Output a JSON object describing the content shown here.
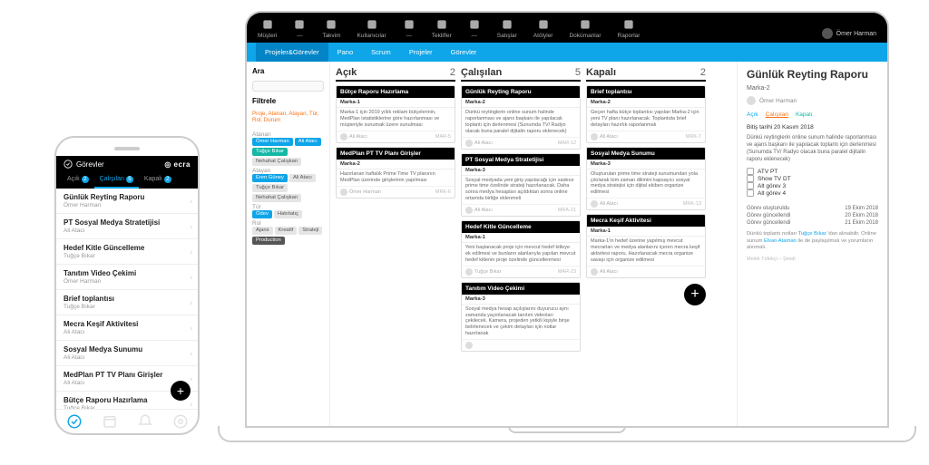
{
  "phone": {
    "header": "Görevler",
    "logo": "ecra",
    "tabs": [
      {
        "label": "Açık",
        "badge": "2"
      },
      {
        "label": "Çalışılan",
        "badge": "5",
        "active": true
      },
      {
        "label": "Kapalı",
        "badge": "2"
      }
    ],
    "items": [
      {
        "t": "Günlük Reyting Raporu",
        "s": "Ömer Harman"
      },
      {
        "t": "PT Sosyal Medya Stratetijisi",
        "s": "Ali Atacı"
      },
      {
        "t": "Hedef Kitle Güncelleme",
        "s": "Tuğçe Bıkar"
      },
      {
        "t": "Tanıtım Video Çekimi",
        "s": "Ömer Harman"
      },
      {
        "t": "Brief toplantısı",
        "s": "Tuğçe Bıkar"
      },
      {
        "t": "Mecra Keşif Aktivitesi",
        "s": "Ali Atacı"
      },
      {
        "t": "Sosyal Medya Sunumu",
        "s": "Ali Atacı"
      },
      {
        "t": "MedPlan PT TV Planı Girişler",
        "s": "Ali Atacı"
      },
      {
        "t": "Bütçe Raporu Hazırlama",
        "s": "Tuğçe Bıkar"
      }
    ]
  },
  "topnav": [
    "Müşteri",
    "—",
    "Takvim",
    "Kullanıcılar",
    "—",
    "Teklifler",
    "—",
    "Satışlar",
    "Atölyler",
    "Dokümanlar",
    "Raporlar"
  ],
  "user": "Ömer Harman",
  "blueTabs": [
    {
      "label": "Projeler&Görevler",
      "active": true
    },
    {
      "label": "Pano"
    },
    {
      "label": "Scrum"
    },
    {
      "label": "Projeler"
    },
    {
      "label": "Görevler"
    }
  ],
  "filters": {
    "searchTitle": "Ara",
    "filtreleTitle": "Filtrele",
    "note": "Proje, Atanan, Atayan, Tür, Rol, Durum",
    "groups": [
      {
        "label": "Atanan",
        "chips": [
          {
            "t": "Ömer Harman",
            "c": "blue"
          },
          {
            "t": "Ali Atacı",
            "c": "blue"
          },
          {
            "t": "Tuğçe Bıkar",
            "c": "teal"
          },
          {
            "t": "Nehahat Çalışkan",
            "c": ""
          }
        ]
      },
      {
        "label": "Atayan",
        "chips": [
          {
            "t": "Eren Güney",
            "c": "blue"
          },
          {
            "t": "Ali Atacı",
            "c": ""
          },
          {
            "t": "Tuğçe Bıkar",
            "c": ""
          },
          {
            "t": "Nehahat Çalışkan",
            "c": ""
          }
        ]
      },
      {
        "label": "Tür",
        "chips": [
          {
            "t": "Ödev",
            "c": "blue"
          },
          {
            "t": "Hatırlatıç",
            "c": ""
          }
        ]
      },
      {
        "label": "Rol",
        "chips": [
          {
            "t": "Ajans",
            "c": ""
          },
          {
            "t": "Kreatif",
            "c": ""
          },
          {
            "t": "Strateji",
            "c": ""
          },
          {
            "t": "Production",
            "c": "dark"
          }
        ]
      }
    ]
  },
  "columns": [
    {
      "name": "Açık",
      "count": "2",
      "cards": [
        {
          "h": "Bütçe Raporu Hazırlama",
          "b": "Marka-1",
          "d": "Marka-1 için 2019 yıllık reklam bütçelerinin, MedPlan istatistiklerine göre hazırlanması ve müşteriyle sunumak üzere sunulması",
          "who": "Ali Atacı",
          "code": "MAR-5"
        },
        {
          "h": "MedPlan PT TV Planı Girişler",
          "b": "Marka-2",
          "d": "Hazırlanan haftalık Prime Time TV planının MedPlan üzerinde girişlerinin yapılması",
          "who": "Ömer Harman",
          "code": "MRK-6"
        }
      ]
    },
    {
      "name": "Çalışılan",
      "count": "5",
      "cards": [
        {
          "h": "Günlük Reyting Raporu",
          "b": "Marka-2",
          "d": "Dünkü reytinglerin online sunum halinde raporlanması ve ajans başkanı ile yapılacak toplantı için derlenmesi (Sunumda TV/ Radyo olacak buna paralel dijitalin raporu eklenecek)",
          "who": "Ali Atacı",
          "code": "MAR-12"
        },
        {
          "h": "PT Sosyal Medya Stratetijisi",
          "b": "Marka-3",
          "d": "Sosyal medyada yeni giriş yapılacağı için sadece prime time özelinde strateji hazırlanacak. Daha sonra medya hesapları açıldıktan sonra online ortamda birliğe eklenmeli",
          "who": "Ali Atacı",
          "code": "MRA-21"
        },
        {
          "h": "Hedef Kitle Güncelleme",
          "b": "Marka-1",
          "d": "Yeni başlanacak proje için mevcut hedef kitleye ek edilmesi ve bunların alanlarıyla yapılan mevcut hedef kitlenin proje özelinde güncellenmesi",
          "who": "Tuğçe Bıkar",
          "code": "MAR-23"
        },
        {
          "h": "Tanıtım Video Çekimi",
          "b": "Marka-3",
          "d": "Sosyal medya hesap açılışlarını duyurucu aynı zamanda yayınlanacak tanıtım videoları çekilecek. Kamera, projeden yetkili kişiyle birşe belirlenecek ve çekim detayları için notlar hazırlanak",
          "who": "",
          "code": ""
        }
      ]
    },
    {
      "name": "Kapalı",
      "count": "2",
      "cards": [
        {
          "h": "Brief toplantısı",
          "b": "Marka-2",
          "d": "Geçen hafta bütçe toplantısı yapılan Marka-2 için yeni TV planı hazırlanacak. Toplantıda brief detayları hazırlık raporlanmalı",
          "who": "Ali Atacı",
          "code": "MRK-7"
        },
        {
          "h": "Sosyal Medya Sunumu",
          "b": "Marka-3",
          "d": "Oluşturulan prime time strateji sunumundan yola çıkılarak tüm zaman dilimini kapsayıcı sosyal medya stratejisi için dijital ekiben organize edilmesi",
          "who": "Ali Atacı",
          "code": "MRK-13"
        },
        {
          "h": "Mecra Keşif Aktivitesi",
          "b": "Marka-1",
          "d": "Marka-1'in hedef üzerine yapılmış mevcut mecrarları ve medya alanlarını içeren mecra keşif aktivitesi raporu. Hazırlanacak mecra organize savaşı için organize edilmesi",
          "who": "Ali Atacı",
          "code": ""
        }
      ]
    }
  ],
  "detail": {
    "title": "Günlük Reyting Raporu",
    "brand": "Marka-2",
    "owner": "Ömer Harman",
    "status": [
      "Açık",
      "Çalışılan",
      "Kapalı"
    ],
    "due": "Bitiş tarihi 20 Kasım 2018",
    "body": "Dünkü reytinglerin online sunum halinde raporlanması ve ajans başkanı ile yapılacak toplantı için derlenmesi (Sunumda TV/ Radyo olacak buna paralel dijitalin raporu eklenecek)",
    "checks": [
      "ATV PT",
      "Show TV DT",
      "Alt görev 3",
      "Alt görev 4"
    ],
    "dates": [
      {
        "l": "Görev oluşturuldu",
        "v": "19 Ekim 2018"
      },
      {
        "l": "Görev güncellendi",
        "v": "20 Ekim 2018"
      },
      {
        "l": "Görev güncellendi",
        "v": "21 Ekim 2018"
      }
    ],
    "footnote_pre": "Dünkü toplantı notları ",
    "footnote_link1": "Tuğçe Bıkar",
    "footnote_mid": " 'dan alınabilir. Online sunum ",
    "footnote_link2": "Elvan Ataman",
    "footnote_post": " ile de paylaşılmalı ve yorumların alınmalı.",
    "meta": "Melek Tüfekçi – Şimdi"
  }
}
